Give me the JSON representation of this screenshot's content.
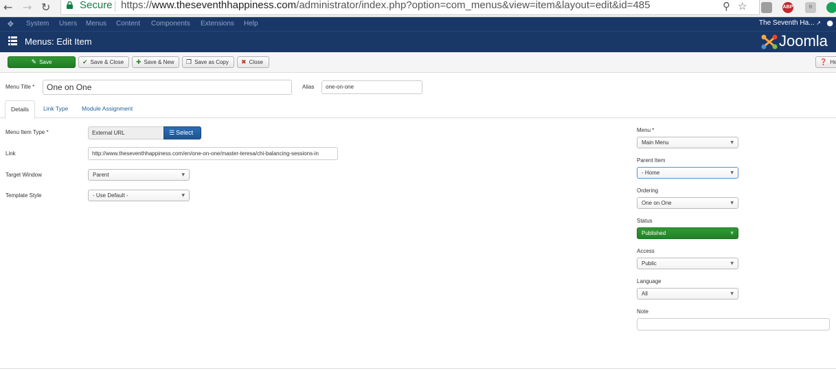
{
  "browser": {
    "secure_label": "Secure",
    "url_scheme": "https://",
    "url_host": "www.theseventhhappiness.com",
    "url_path": "/administrator/index.php?option=com_menus&view=item&layout=edit&id=485",
    "extensions": [
      "",
      "ABP",
      "B",
      ""
    ]
  },
  "topnav": {
    "items": [
      "System",
      "Users",
      "Menus",
      "Content",
      "Components",
      "Extensions",
      "Help"
    ],
    "site_name": "The Seventh Ha..."
  },
  "header": {
    "title": "Menus: Edit Item",
    "logo_text": "Joomla"
  },
  "toolbar": {
    "save": "Save",
    "save_close": "Save & Close",
    "save_new": "Save & New",
    "save_copy": "Save as Copy",
    "close": "Close",
    "help": "He"
  },
  "form": {
    "menu_title_label": "Menu Title *",
    "menu_title_value": "One on One",
    "alias_label": "Alias",
    "alias_value": "one-on-one"
  },
  "tabs": [
    "Details",
    "Link Type",
    "Module Assignment"
  ],
  "details": {
    "type_label": "Menu Item Type *",
    "type_value": "External URL",
    "select_label": "Select",
    "link_label": "Link",
    "link_value": "http://www.theseventhhappiness.com/en/one-on-one/master-teresa/chi-balancing-sessions-in",
    "target_label": "Target Window",
    "target_value": "Parent",
    "template_label": "Template Style",
    "template_value": "- Use Default -"
  },
  "side": {
    "menu_label": "Menu *",
    "menu_value": "Main Menu",
    "parent_label": "Parent Item",
    "parent_value": "- Home",
    "ordering_label": "Ordering",
    "ordering_value": "One on One",
    "status_label": "Status",
    "status_value": "Published",
    "access_label": "Access",
    "access_value": "Public",
    "language_label": "Language",
    "language_value": "All",
    "note_label": "Note",
    "note_value": ""
  },
  "colors": {
    "nav_bg": "#1a3867",
    "save_green": "#2f9a33",
    "select_blue": "#2a6db6",
    "link_blue": "#1f5f9c"
  }
}
